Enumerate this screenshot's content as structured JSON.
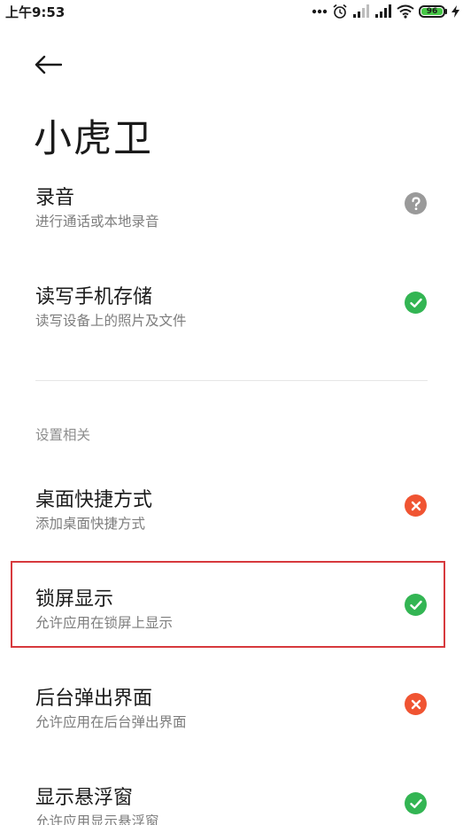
{
  "status_bar": {
    "time": "上午9:53",
    "battery_level": "96",
    "icons": [
      "more-dots-icon",
      "alarm-icon",
      "signal-icon",
      "signal-icon",
      "wifi-icon",
      "battery-icon",
      "charging-icon"
    ]
  },
  "header": {
    "back_icon": "back-arrow-icon",
    "title": "小虎卫"
  },
  "permissions": [
    {
      "title": "录音",
      "subtitle": "进行通话或本地录音",
      "status": "unknown",
      "status_icon": "question-icon"
    },
    {
      "title": "读写手机存储",
      "subtitle": "读写设备上的照片及文件",
      "status": "allowed",
      "status_icon": "check-icon"
    }
  ],
  "settings_section": {
    "label": "设置相关",
    "items": [
      {
        "title": "桌面快捷方式",
        "subtitle": "添加桌面快捷方式",
        "status": "denied",
        "status_icon": "cross-icon"
      },
      {
        "title": "锁屏显示",
        "subtitle": "允许应用在锁屏上显示",
        "status": "allowed",
        "status_icon": "check-icon",
        "highlighted": true
      },
      {
        "title": "后台弹出界面",
        "subtitle": "允许应用在后台弹出界面",
        "status": "denied",
        "status_icon": "cross-icon"
      },
      {
        "title": "显示悬浮窗",
        "subtitle": "允许应用显示悬浮窗",
        "status": "allowed",
        "status_icon": "check-icon"
      }
    ]
  },
  "colors": {
    "allowed": "#33b553",
    "denied": "#f05432",
    "unknown": "#9a9a9a",
    "highlight": "#d7393d"
  }
}
